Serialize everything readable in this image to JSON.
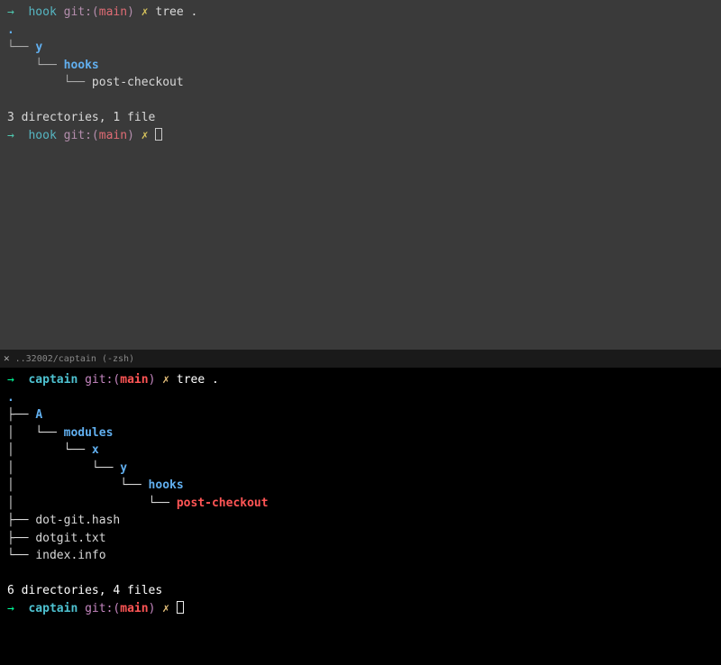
{
  "top": {
    "prompt1": {
      "arrow": "→",
      "dir": "hook",
      "git_label": "git:(",
      "branch": "main",
      "git_close": ")",
      "dirty": "✗",
      "command": "tree ."
    },
    "tree_root": ".",
    "tree_l1_prefix": "└── ",
    "tree_l1_name": "y",
    "tree_l2_prefix": "    └── ",
    "tree_l2_name": "hooks",
    "tree_l3_prefix": "        └── ",
    "tree_l3_name": "post-checkout",
    "summary": "3 directories, 1 file",
    "prompt2": {
      "arrow": "→",
      "dir": "hook",
      "git_label": "git:(",
      "branch": "main",
      "git_close": ")",
      "dirty": "✗"
    }
  },
  "tab": {
    "title": "..32002/captain (-zsh)"
  },
  "bottom": {
    "prompt1": {
      "arrow": "→",
      "dir": "captain",
      "git_label": "git:(",
      "branch": "main",
      "git_close": ")",
      "dirty": "✗",
      "command": "tree ."
    },
    "tree_root": ".",
    "l1a_prefix": "├── ",
    "l1a_name": "A",
    "l2_prefix": "│   └── ",
    "l2_name": "modules",
    "l3_prefix": "│       └── ",
    "l3_name": "x",
    "l4_prefix": "│           └── ",
    "l4_name": "y",
    "l5_prefix": "│               └── ",
    "l5_name": "hooks",
    "l6_prefix": "│                   └── ",
    "l6_name": "post-checkout",
    "l1b_prefix": "├── ",
    "l1b_name": "dot-git.hash",
    "l1c_prefix": "├── ",
    "l1c_name": "dotgit.txt",
    "l1d_prefix": "└── ",
    "l1d_name": "index.info",
    "summary": "6 directories, 4 files",
    "prompt2": {
      "arrow": "→",
      "dir": "captain",
      "git_label": "git:(",
      "branch": "main",
      "git_close": ")",
      "dirty": "✗"
    }
  }
}
